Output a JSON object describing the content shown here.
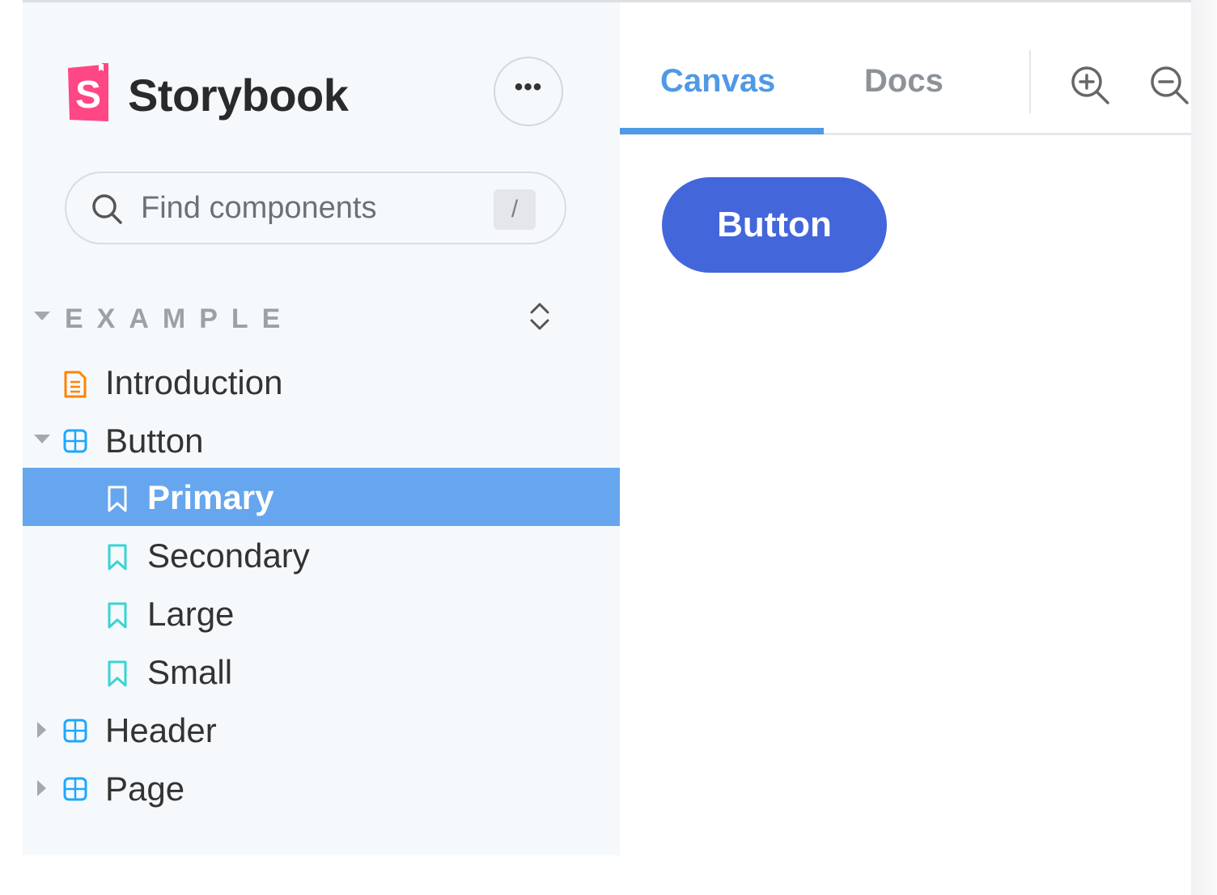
{
  "app": {
    "brand": "Storybook",
    "logo_letter": "S",
    "brand_color": "#ff4785"
  },
  "sidebar": {
    "menu_icon": "ellipsis-icon",
    "search": {
      "placeholder": "Find components",
      "value": "",
      "shortcut": "/"
    },
    "section": {
      "label": "EXAMPLE"
    },
    "items": [
      {
        "label": "Introduction",
        "icon": "document-icon",
        "level": 1
      },
      {
        "label": "Button",
        "icon": "component-icon",
        "level": 1,
        "expanded": true
      },
      {
        "label": "Primary",
        "icon": "bookmark-icon",
        "level": 2,
        "selected": true
      },
      {
        "label": "Secondary",
        "icon": "bookmark-icon",
        "level": 2
      },
      {
        "label": "Large",
        "icon": "bookmark-icon",
        "level": 2
      },
      {
        "label": "Small",
        "icon": "bookmark-icon",
        "level": 2
      },
      {
        "label": "Header",
        "icon": "component-icon",
        "level": 1,
        "expanded": false
      },
      {
        "label": "Page",
        "icon": "component-icon",
        "level": 1,
        "expanded": false
      }
    ]
  },
  "toolbar": {
    "tabs": [
      {
        "label": "Canvas",
        "active": true
      },
      {
        "label": "Docs",
        "active": false
      }
    ],
    "tools": [
      "zoom-in-icon",
      "zoom-out-icon"
    ]
  },
  "canvas": {
    "button_label": "Button"
  },
  "colors": {
    "accent": "#4f99e6",
    "selected_row": "#66a6ee",
    "primary_button": "#4466db",
    "story_icon": "#37d5d3",
    "doc_icon": "#ff8300",
    "component_icon": "#1ea7fd"
  }
}
